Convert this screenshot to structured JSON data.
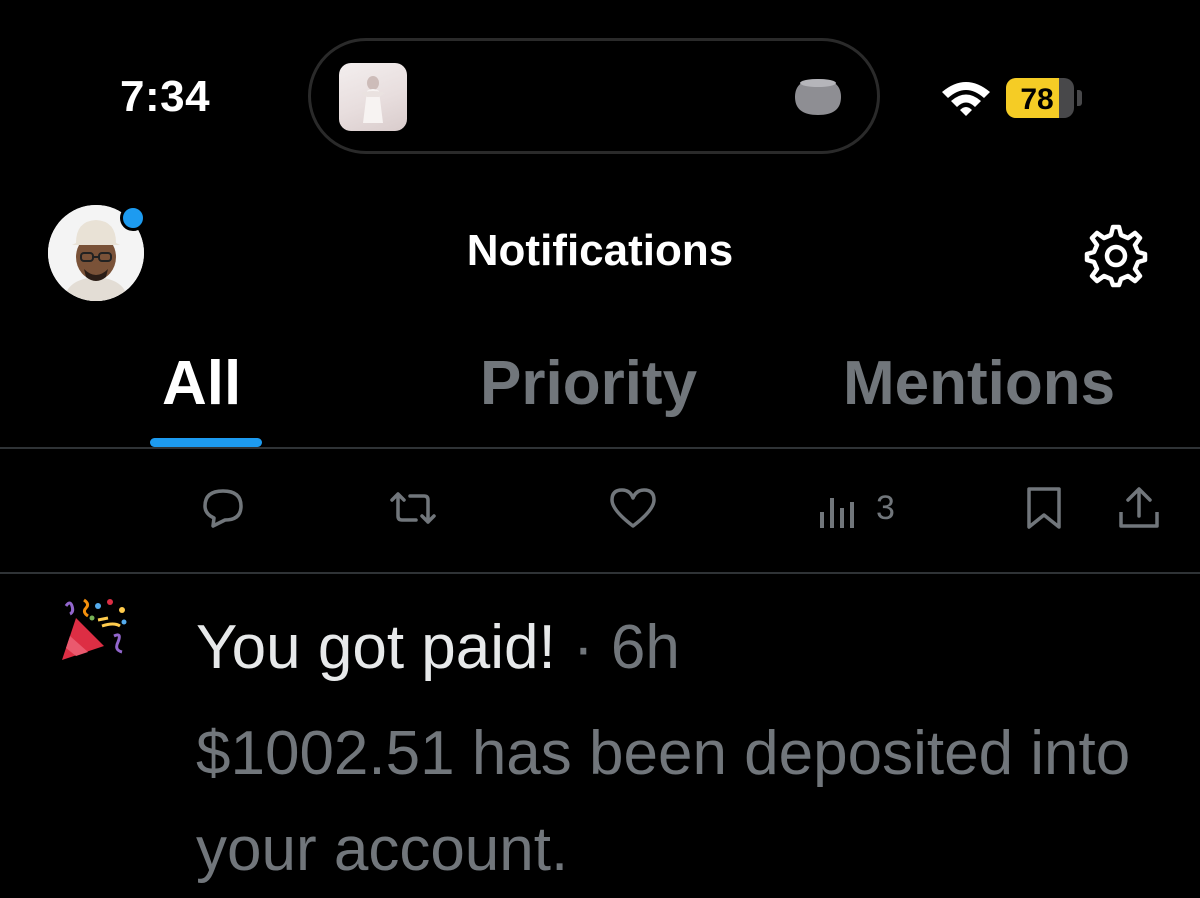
{
  "status_bar": {
    "time": "7:34",
    "battery_percent": 78,
    "battery_label": "78",
    "icons": [
      "album-art-thumbnail",
      "homepod-icon",
      "wifi-icon",
      "battery-icon"
    ]
  },
  "header": {
    "title": "Notifications",
    "avatar_badge_color": "#1d9bf0",
    "icons": [
      "avatar",
      "gear-icon"
    ]
  },
  "tabs": [
    {
      "label": "All",
      "active": true
    },
    {
      "label": "Priority",
      "active": false
    },
    {
      "label": "Mentions",
      "active": false
    }
  ],
  "actions": {
    "items": [
      "reply-icon",
      "retweet-icon",
      "like-icon",
      "views-icon",
      "bookmark-icon",
      "share-icon"
    ],
    "views_count": "3"
  },
  "notification": {
    "icon": "party-popper-icon",
    "headline": "You got paid!",
    "separator": "·",
    "time_ago": "6h",
    "body": "$1002.51 has been deposited into your account."
  },
  "colors": {
    "background": "#000000",
    "accent": "#1d9bf0",
    "muted_text": "#71767b",
    "primary_text": "#e7e9ea",
    "battery_fill": "#f5cc25"
  }
}
